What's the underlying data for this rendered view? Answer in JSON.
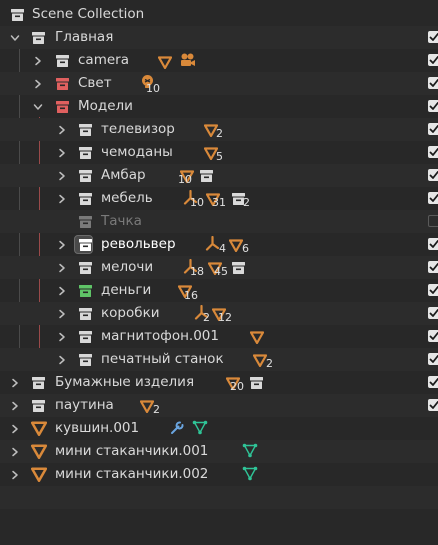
{
  "outliner": {
    "root_label": "Scene Collection",
    "rows": [
      {
        "label": "Главная"
      },
      {
        "label": "camera"
      },
      {
        "label": "Свет",
        "count": "10"
      },
      {
        "label": "Модели"
      },
      {
        "label": "телевизор",
        "count": "2"
      },
      {
        "label": "чемоданы",
        "count": "5"
      },
      {
        "label": "Амбар",
        "count": "10"
      },
      {
        "label": "мебель",
        "counts": [
          "10",
          "31",
          "2"
        ]
      },
      {
        "label": "Тачка"
      },
      {
        "label": "револьвер",
        "counts": [
          "4",
          "6"
        ]
      },
      {
        "label": "мелочи",
        "counts": [
          "18",
          "45"
        ]
      },
      {
        "label": "деньги",
        "count": "16"
      },
      {
        "label": "коробки",
        "counts": [
          "2",
          "12"
        ]
      },
      {
        "label": "магнитофон.001"
      },
      {
        "label": "печатный станок",
        "count": "2"
      },
      {
        "label": "Бумажные изделия",
        "count": "20"
      },
      {
        "label": "паутина",
        "count": "2"
      },
      {
        "label": "кувшин.001"
      },
      {
        "label": "мини стаканчики.001"
      },
      {
        "label": "мини стаканчики.002"
      }
    ]
  },
  "colors": {
    "background": "#282828",
    "text": "#d9d9d9",
    "disabled_text": "#7a7a7a",
    "mesh_orange": "#d9893a",
    "collection_red": "#e0605f",
    "collection_green": "#5fc467",
    "modifier_blue": "#6aa5e0",
    "vertex_group_teal": "#2fc497"
  }
}
